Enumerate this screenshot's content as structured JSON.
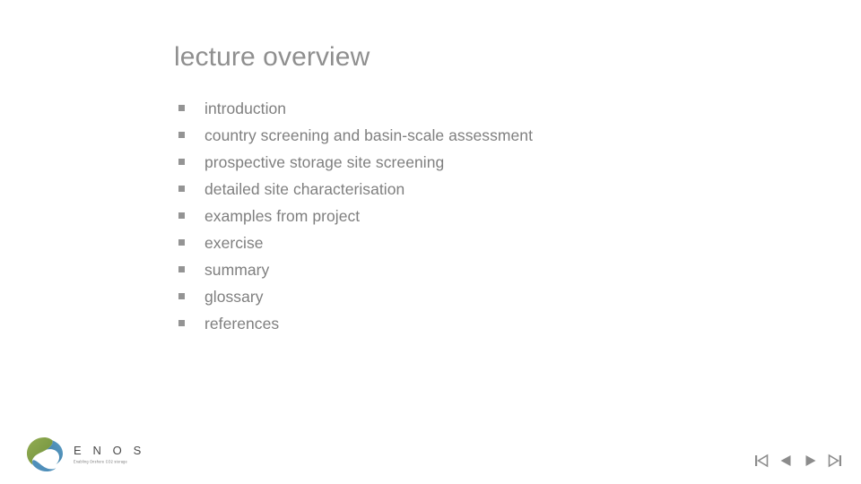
{
  "slide": {
    "title": "lecture overview",
    "background_color": "#ffffff",
    "title_color": "#8f8f8f",
    "body_color": "#7f7f7f",
    "bullet_marker_color": "#949494",
    "bullet_glyph": "square-bullet"
  },
  "outline": {
    "items": [
      {
        "text": "introduction"
      },
      {
        "text": "country screening and basin-scale assessment"
      },
      {
        "text": "prospective storage site screening"
      },
      {
        "text": "detailed site characterisation"
      },
      {
        "text": "examples from project"
      },
      {
        "text": "exercise"
      },
      {
        "text": "summary"
      },
      {
        "text": "glossary"
      },
      {
        "text": "references"
      }
    ]
  },
  "logo": {
    "name": "enos-logo",
    "wordmark": "E N O S",
    "tagline": "Enabling Onshore CO2 storage",
    "ring_green": "#7d9b43",
    "ring_blue": "#4f8fba",
    "ring_teal": "#3f7fa8"
  },
  "navigation": {
    "first_label": "First slide",
    "previous_label": "Previous slide",
    "next_label": "Next slide",
    "last_label": "Last slide",
    "icon_color": "#8c8c8c"
  }
}
